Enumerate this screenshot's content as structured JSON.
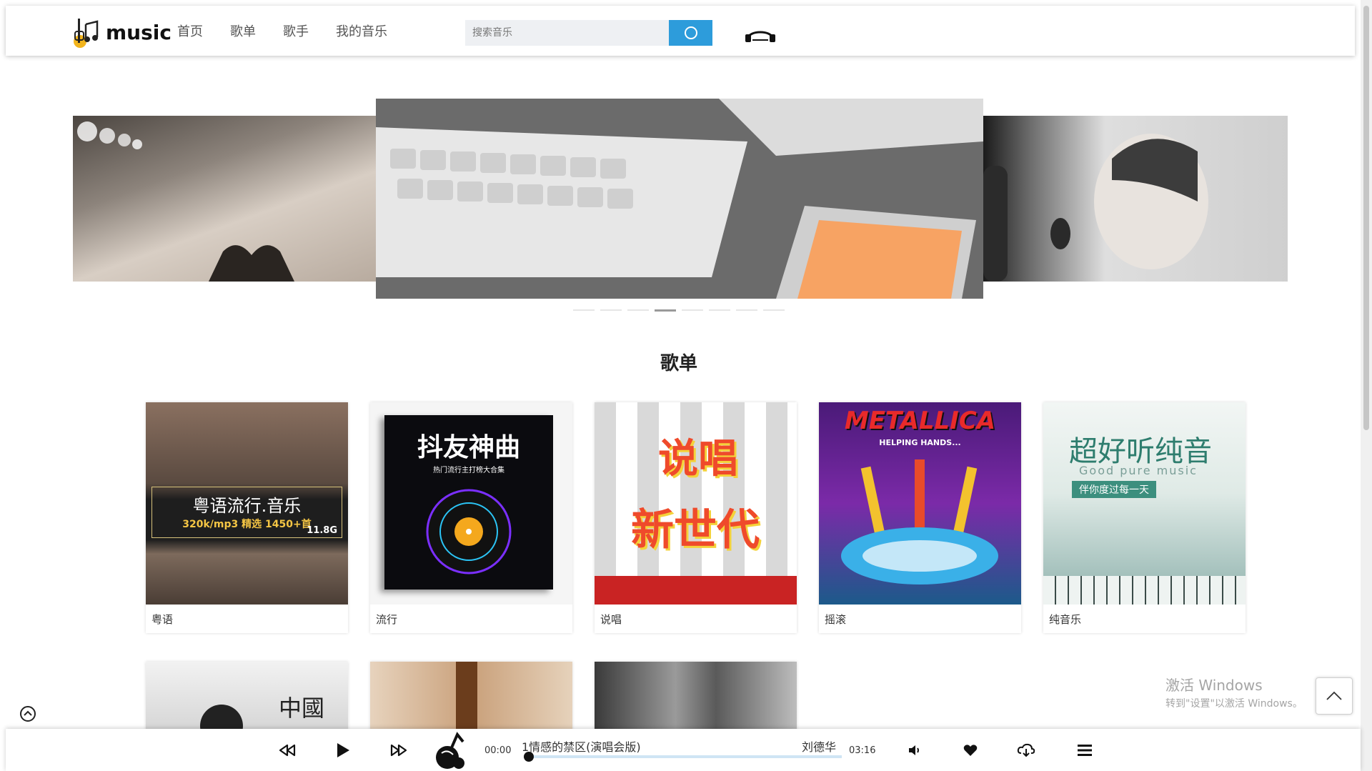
{
  "header": {
    "logo_text": "music",
    "nav": [
      "首页",
      "歌单",
      "歌手",
      "我的音乐"
    ],
    "search_placeholder": "搜索音乐"
  },
  "carousel": {
    "dot_count": 8,
    "active_index": 3
  },
  "playlists": {
    "title": "歌单",
    "items": [
      {
        "label": "粤语",
        "cover_text": "粤语流行.音乐",
        "cover_sub": "320k/mp3  精选 1450+首",
        "cover_size": "11.8G"
      },
      {
        "label": "流行",
        "cover_text": "抖友神曲",
        "cover_sub": "热门流行主打榜大合集"
      },
      {
        "label": "说唱",
        "cover_text": "说唱",
        "cover_text2": "新世代"
      },
      {
        "label": "摇滚",
        "cover_text": "METALLICA",
        "cover_sub": "HELPING HANDS..."
      },
      {
        "label": "纯音乐",
        "cover_text": "超好听纯音",
        "cover_sub": "Good pure music",
        "cover_badge": "伴你度过每一天"
      }
    ],
    "second_row_cover_text": "中國"
  },
  "system": {
    "activate_title": "激活 Windows",
    "activate_sub": "转到\"设置\"以激活 Windows。"
  },
  "player": {
    "current_time": "00:00",
    "song_title": "1情感的禁区(演唱会版)",
    "artist": "刘德华",
    "total_time": "03:16",
    "progress": 0
  },
  "colors": {
    "accent": "#2d9cdb"
  }
}
